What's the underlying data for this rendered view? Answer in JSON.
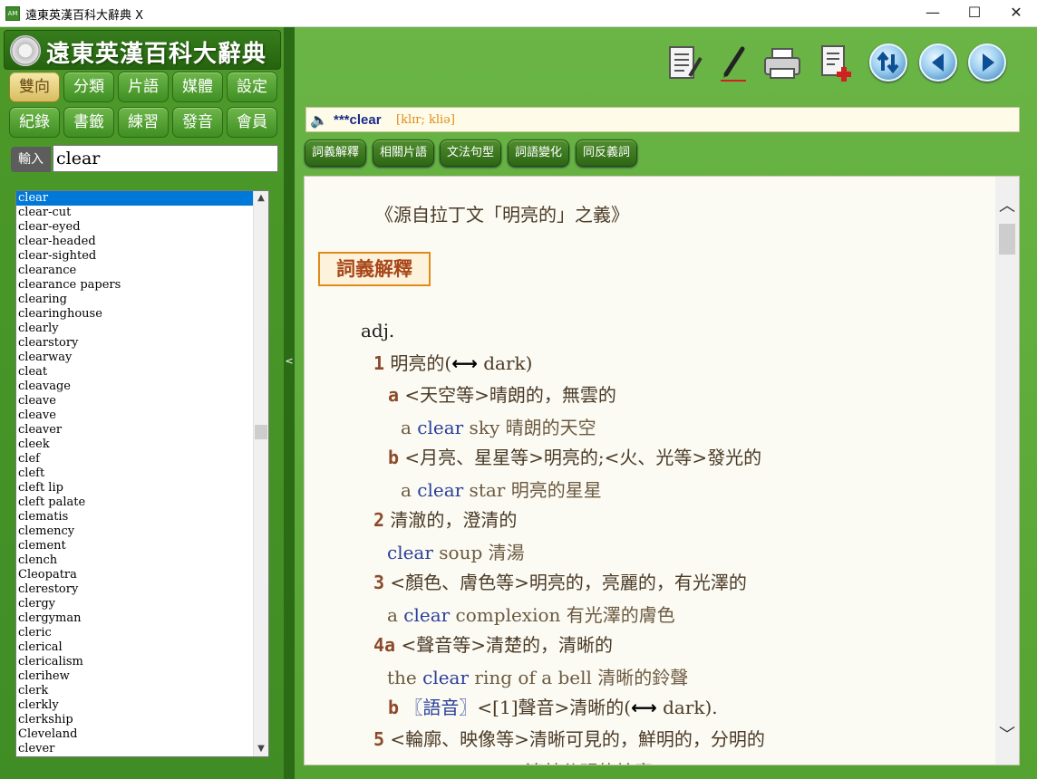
{
  "window": {
    "icon_text": "AM",
    "title": "遠東英漢百科大辭典 X",
    "minimize": "—",
    "maximize": "☐",
    "close": "✕"
  },
  "logo": {
    "title": "遠東英漢百科大辭典"
  },
  "nav": {
    "row1": [
      "雙向",
      "分類",
      "片語",
      "媒體",
      "設定"
    ],
    "row2": [
      "紀錄",
      "書籤",
      "練習",
      "發音",
      "會員"
    ],
    "active": "雙向"
  },
  "input": {
    "label": "輸入",
    "value": "clear"
  },
  "wordlist": [
    "clear",
    "clear-cut",
    "clear-eyed",
    "clear-headed",
    "clear-sighted",
    "clearance",
    "clearance papers",
    "clearing",
    "clearinghouse",
    "clearly",
    "clearstory",
    "clearway",
    "cleat",
    "cleavage",
    "cleave",
    "cleave",
    "cleaver",
    "cleek",
    "clef",
    "cleft",
    "cleft lip",
    "cleft palate",
    "clematis",
    "clemency",
    "clement",
    "clench",
    "Cleopatra",
    "clerestory",
    "clergy",
    "clergyman",
    "cleric",
    "clerical",
    "clericalism",
    "clerihew",
    "clerk",
    "clerkly",
    "clerkship",
    "Cleveland",
    "clever"
  ],
  "splitter_glyph": "<",
  "toolbar": [
    "notes-icon",
    "pen-icon",
    "print-icon",
    "add-page-icon",
    "swap-icon",
    "back-icon",
    "forward-icon"
  ],
  "headword": {
    "speaker": "🔈",
    "prefix": "***",
    "word": "clear",
    "ipa": "[klɪr; kliə]"
  },
  "tabs": [
    "詞義解釋",
    "相關片語",
    "文法句型",
    "詞語變化",
    "同反義詞"
  ],
  "entry": {
    "etymology": "《源自拉丁文「明亮的」之義》",
    "section": "詞義解釋",
    "pos": "adj.",
    "arrow": "⟷",
    "s1_num": "1",
    "s1_text": "明亮的(",
    "s1_ant": " dark)",
    "s1a_num": "a",
    "s1a_text": "<天空等>晴朗的，無雲的",
    "s1a_ex_pre": "a ",
    "s1a_ex_word": "clear",
    "s1a_ex_post": " sky 晴朗的天空",
    "s1b_num": "b",
    "s1b_text": "<月亮、星星等>明亮的;<火、光等>發光的",
    "s1b_ex_pre": "a ",
    "s1b_ex_word": "clear",
    "s1b_ex_post": " star 明亮的星星",
    "s2_num": "2",
    "s2_text": "清澈的，澄清的",
    "s2_ex_word": "clear",
    "s2_ex_post": " soup 清湯",
    "s3_num": "3",
    "s3_text": "<顏色、膚色等>明亮的，亮麗的，有光澤的",
    "s3_ex_pre": "a ",
    "s3_ex_word": "clear",
    "s3_ex_post": " complexion 有光澤的膚色",
    "s4a_num": "4a",
    "s4a_text": "<聲音等>清楚的，清晰的",
    "s4a_ex_pre": "the ",
    "s4a_ex_word": "clear",
    "s4a_ex_post": " ring of a bell 清晰的鈴聲",
    "s4b_num": "b",
    "s4b_label": "〖語音〗",
    "s4b_text": "<[1]聲音>清晰的(",
    "s4b_ant": " dark).",
    "s5_num": "5",
    "s5_text": "<輪廓、映像等>清晰可見的，鮮明的，分明的",
    "s5_ex": "a clear outline 清楚分明的輪廓"
  }
}
